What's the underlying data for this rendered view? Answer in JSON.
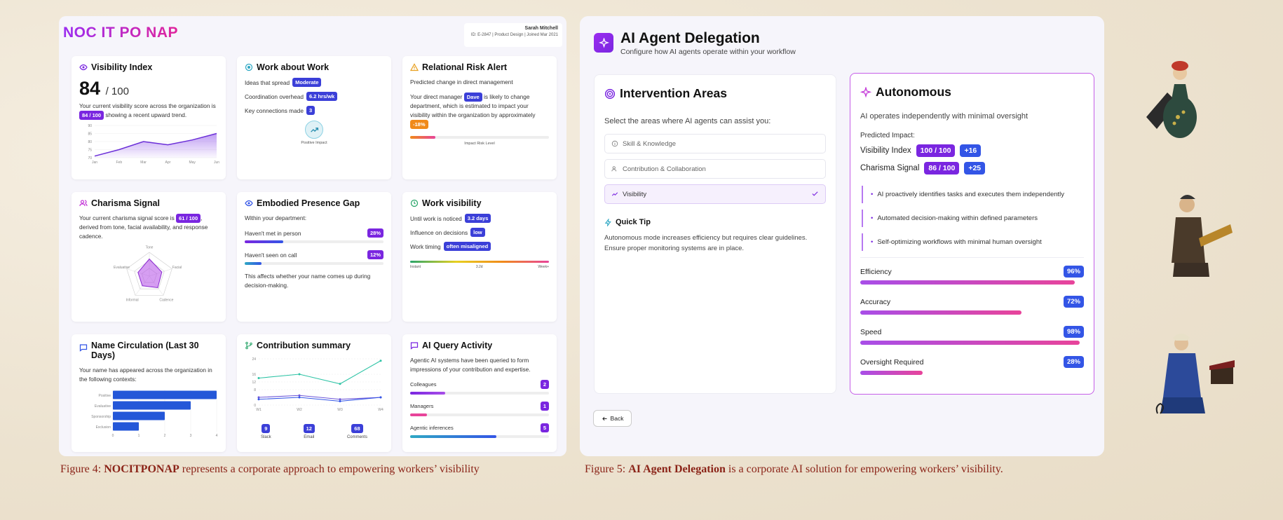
{
  "panel1": {
    "logo": "NOC IT PO NAP",
    "user": {
      "name": "Sarah Mitchell",
      "meta": "ID: E-2847 | Product Design | Joined Mar 2021"
    },
    "visibility": {
      "title": "Visibility Index",
      "score": "84",
      "out_of": "/ 100",
      "text_a": "Your current visibility score across the organization is",
      "pill": "84 / 100",
      "text_b": "showing a recent upward trend.",
      "chart_data": {
        "type": "area",
        "x": [
          "Jan",
          "Feb",
          "Mar",
          "Apr",
          "May",
          "Jun"
        ],
        "values": [
          71,
          75,
          80,
          78,
          81,
          85
        ],
        "y_ticks": [
          "90",
          "85",
          "80",
          "75",
          "70"
        ],
        "ylim": [
          70,
          90
        ]
      }
    },
    "work_about_work": {
      "title": "Work about Work",
      "rows": [
        {
          "label": "Ideas that spread",
          "value": "Moderate"
        },
        {
          "label": "Coordination overhead",
          "value": "6.2 hrs/wk"
        },
        {
          "label": "Key connections made",
          "value": "3"
        }
      ],
      "impact_label": "Positive Impact"
    },
    "relational_risk": {
      "title": "Relational Risk Alert",
      "subtitle": "Predicted change in direct management",
      "text_a": "Your direct manager",
      "manager": "Dave",
      "text_b": "is likely to change department, which is estimated to impact your visibility within the organization by approximately",
      "impact": "-18%",
      "bar_label": "Impact Risk Level",
      "risk_level": 0.18
    },
    "charisma": {
      "title": "Charisma Signal",
      "text_a": "Your current charisma signal score is",
      "pill": "61 / 100",
      "text_b": ", derived from tone, facial availability, and response cadence.",
      "chart_data": {
        "type": "radar",
        "axes": [
          "Tone",
          "Facial",
          "Cadence",
          "Informal",
          "Evaluative"
        ],
        "values": [
          0.72,
          0.55,
          0.6,
          0.5,
          0.5
        ]
      }
    },
    "embodied": {
      "title": "Embodied Presence Gap",
      "subtitle": "Within your department:",
      "rows": [
        {
          "label": "Haven't met in person",
          "value": "28%",
          "fraction": 0.28
        },
        {
          "label": "Haven't seen on call",
          "value": "12%",
          "fraction": 0.12
        }
      ],
      "footer": "This affects whether your name comes up during decision-making."
    },
    "work_visibility": {
      "title": "Work visibility",
      "rows": [
        {
          "label": "Until work is noticed",
          "value": "3.2 days"
        },
        {
          "label": "Influence on decisions",
          "value": "low"
        },
        {
          "label": "Work timing",
          "value": "often misaligned"
        }
      ],
      "scale": [
        "Instant",
        "3.2d",
        "Week+"
      ]
    },
    "name_circulation": {
      "title": "Name Circulation (Last 30 Days)",
      "text": "Your name has appeared across the organization in the following contexts:",
      "chart_data": {
        "type": "bar",
        "categories": [
          "Positive",
          "Evaluative",
          "Sponsorship",
          "Exclusion"
        ],
        "values": [
          4,
          3,
          2,
          1
        ],
        "x_ticks": [
          "0",
          "1",
          "2",
          "3",
          "4"
        ],
        "xlim": [
          0,
          4
        ]
      }
    },
    "contribution": {
      "title": "Contribution summary",
      "chart_data": {
        "type": "line",
        "x": [
          "W1",
          "W2",
          "W3",
          "W4"
        ],
        "y_ticks": [
          "24",
          "16",
          "12",
          "8",
          "0"
        ],
        "ylim": [
          0,
          24
        ],
        "series": [
          {
            "values": [
              14,
              16,
              11,
              23
            ],
            "color": "#2fc4a6"
          },
          {
            "values": [
              4,
              5,
              3,
              4
            ],
            "color": "#6b55d8"
          },
          {
            "values": [
              3,
              4,
              2,
              4
            ],
            "color": "#3355e6"
          }
        ]
      },
      "totals": [
        {
          "value": "9",
          "label": "Slack"
        },
        {
          "value": "12",
          "label": "Email"
        },
        {
          "value": "68",
          "label": "Comments"
        }
      ]
    },
    "ai_query": {
      "title": "AI Query Activity",
      "text": "Agentic AI systems have been queried to form impressions of your contribution and expertise.",
      "rows": [
        {
          "label": "Colleagues",
          "value": "2",
          "fraction": 0.25
        },
        {
          "label": "Managers",
          "value": "1",
          "fraction": 0.12
        },
        {
          "label": "Agentic inferences",
          "value": "5",
          "fraction": 0.62
        }
      ]
    }
  },
  "panel2": {
    "title": "AI Agent Delegation",
    "subtitle": "Configure how AI agents operate within your workflow",
    "intervention": {
      "title": "Intervention Areas",
      "prompt": "Select the areas where AI agents can assist you:",
      "options": [
        {
          "label": "Skill & Knowledge",
          "selected": false
        },
        {
          "label": "Contribution & Collaboration",
          "selected": false
        },
        {
          "label": "Visibility",
          "selected": true
        }
      ],
      "tip_title": "Quick Tip",
      "tip_text": "Autonomous mode increases efficiency but requires clear guidelines. Ensure proper monitoring systems are in place."
    },
    "autonomous": {
      "title": "Autonomous",
      "subtitle": "AI operates independently with minimal oversight",
      "predicted": "Predicted Impact:",
      "impacts": [
        {
          "label": "Visibility Index",
          "value": "100 / 100",
          "delta": "+16"
        },
        {
          "label": "Charisma Signal",
          "value": "86 / 100",
          "delta": "+25"
        }
      ],
      "bullets": [
        "AI proactively identifies tasks and executes them independently",
        "Automated decision-making within defined parameters",
        "Self-optimizing workflows with minimal human oversight"
      ],
      "metrics": [
        {
          "label": "Efficiency",
          "value": "96%",
          "fraction": 0.96
        },
        {
          "label": "Accuracy",
          "value": "72%",
          "fraction": 0.72
        },
        {
          "label": "Speed",
          "value": "98%",
          "fraction": 0.98
        },
        {
          "label": "Oversight Required",
          "value": "28%",
          "fraction": 0.28
        }
      ]
    },
    "back_label": "Back"
  },
  "captions": {
    "fig4_prefix": "Figure 4: ",
    "fig4_bold": "NOCITPONAP",
    "fig4_rest": " represents a corporate approach to empowering workers’ visibility",
    "fig5_prefix": "Figure 5: ",
    "fig5_bold": "AI Agent Delegation",
    "fig5_rest": " is a corporate AI solution for empowering workers’ visibility."
  },
  "colors": {
    "accent_purple": "#7a26e0",
    "accent_blue": "#3355e6",
    "caption": "#8b2418"
  }
}
